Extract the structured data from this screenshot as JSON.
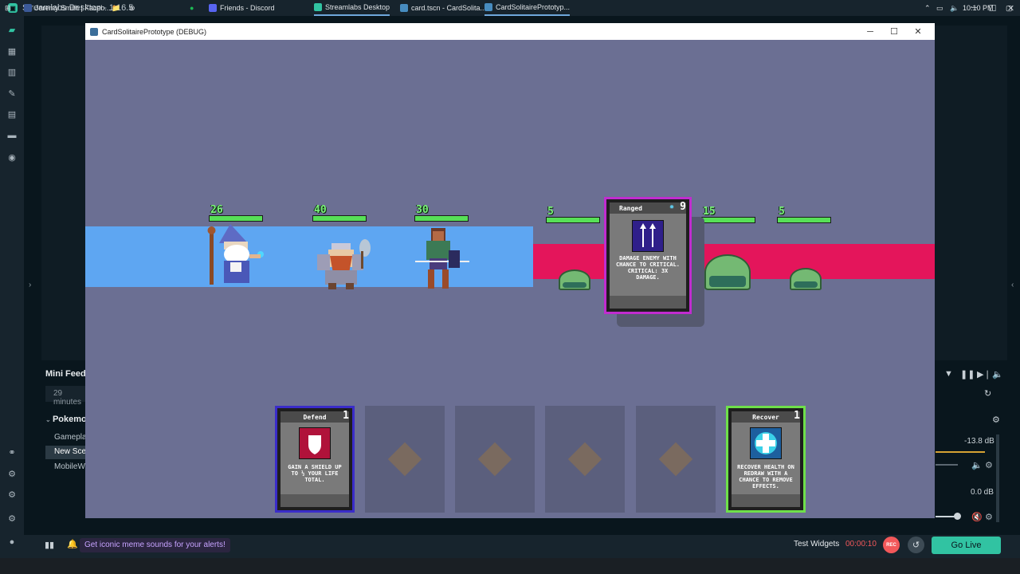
{
  "streamlabs": {
    "title": "Streamlabs Desktop - 1.16.5",
    "mini_feed": {
      "title": "Mini Feed",
      "row": "29 minutes"
    },
    "scenes": {
      "title": "Pokemo",
      "items": [
        "Gameplay",
        "New Scene",
        "MobileWi"
      ],
      "active_index": 1
    },
    "mixer": {
      "db1": "-13.8 dB",
      "db2": "0.0 dB"
    },
    "bottom": {
      "alert": "Get iconic meme sounds for your alerts!",
      "test_widgets": "Test Widgets",
      "timer": "00:00:10",
      "rec": "REC",
      "go_live": "Go Live"
    }
  },
  "game": {
    "window_title": "CardSolitairePrototype (DEBUG)",
    "heroes": [
      {
        "name": "wizard",
        "hp": "26"
      },
      {
        "name": "dwarf",
        "hp": "40"
      },
      {
        "name": "ranger",
        "hp": "30"
      }
    ],
    "enemies": [
      {
        "name": "slime-1",
        "hp": "5"
      },
      {
        "name": "slime-2",
        "hp": "15"
      },
      {
        "name": "slime-3",
        "hp": "5"
      }
    ],
    "held_card": {
      "title": "Ranged",
      "cost": "9",
      "desc": "Damage enemy with chance to critical. Critical: 3x damage."
    },
    "hand": [
      {
        "title": "Defend",
        "cost": "1",
        "desc": "Gain a shield up to ½ your life total."
      },
      {
        "title": "Recover",
        "cost": "1",
        "desc": "Recover health on redraw with a chance to remove effects."
      }
    ]
  },
  "taskbar": {
    "items": [
      "Jeremy Smith | Faceb...",
      "Friends - Discord",
      "Streamlabs Desktop",
      "card.tscn - CardSolita...",
      "CardSolitairePrototyp..."
    ],
    "time": "10:10 PM"
  },
  "colors": {
    "accent": "#31c3a2",
    "rec": "#f2585a",
    "lane_blue": "#5ea6f2",
    "lane_red": "#e4155b",
    "hp_green": "#57e057"
  }
}
